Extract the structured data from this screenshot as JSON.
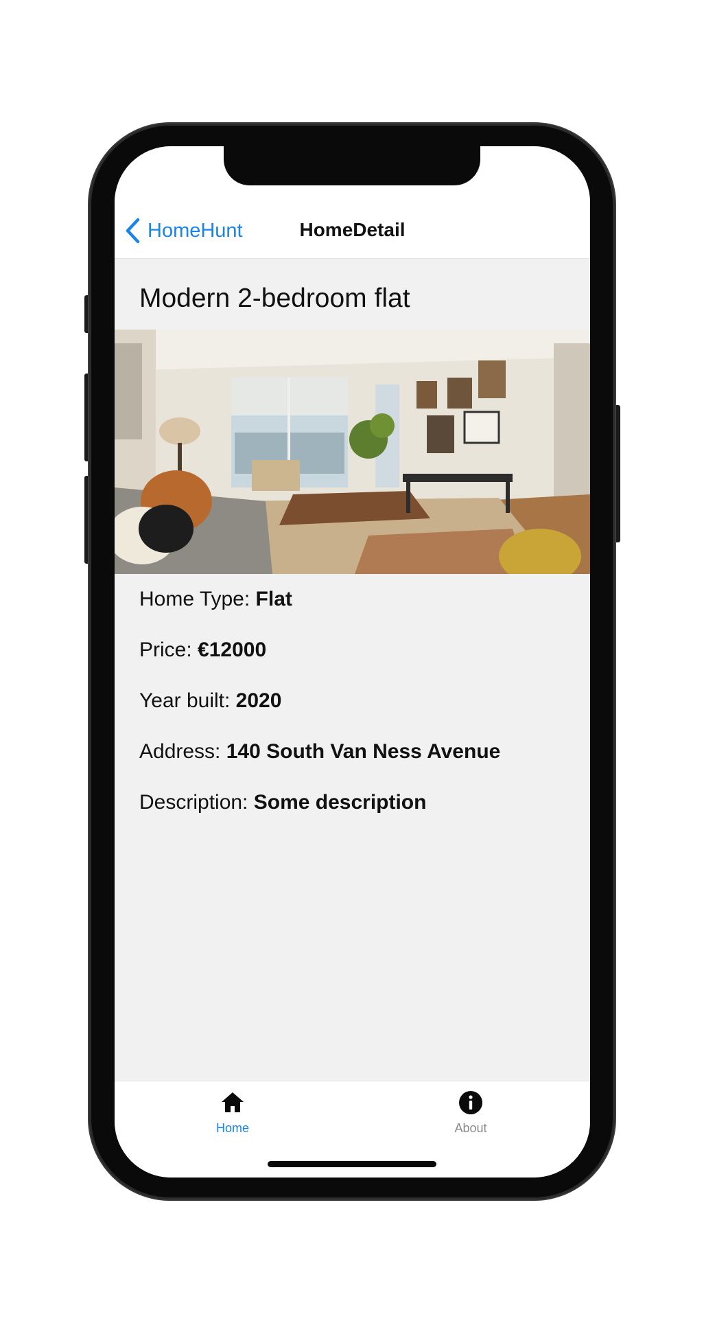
{
  "nav": {
    "back_label": "HomeHunt",
    "title": "HomeDetail"
  },
  "home": {
    "title": "Modern 2-bedroom flat",
    "details": [
      {
        "label": "Home Type: ",
        "value": "Flat"
      },
      {
        "label": "Price: ",
        "value": "€12000"
      },
      {
        "label": "Year built: ",
        "value": "2020"
      },
      {
        "label": "Address: ",
        "value": "140 South Van Ness Avenue"
      },
      {
        "label": "Description: ",
        "value": "Some description"
      }
    ]
  },
  "tabs": [
    {
      "label": "Home",
      "icon": "house-icon",
      "active": true
    },
    {
      "label": "About",
      "icon": "info-circle-icon",
      "active": false
    }
  ],
  "colors": {
    "accent": "#1a84e8",
    "background": "#f1f1f1",
    "inactive_tab": "#8a8a8a"
  }
}
